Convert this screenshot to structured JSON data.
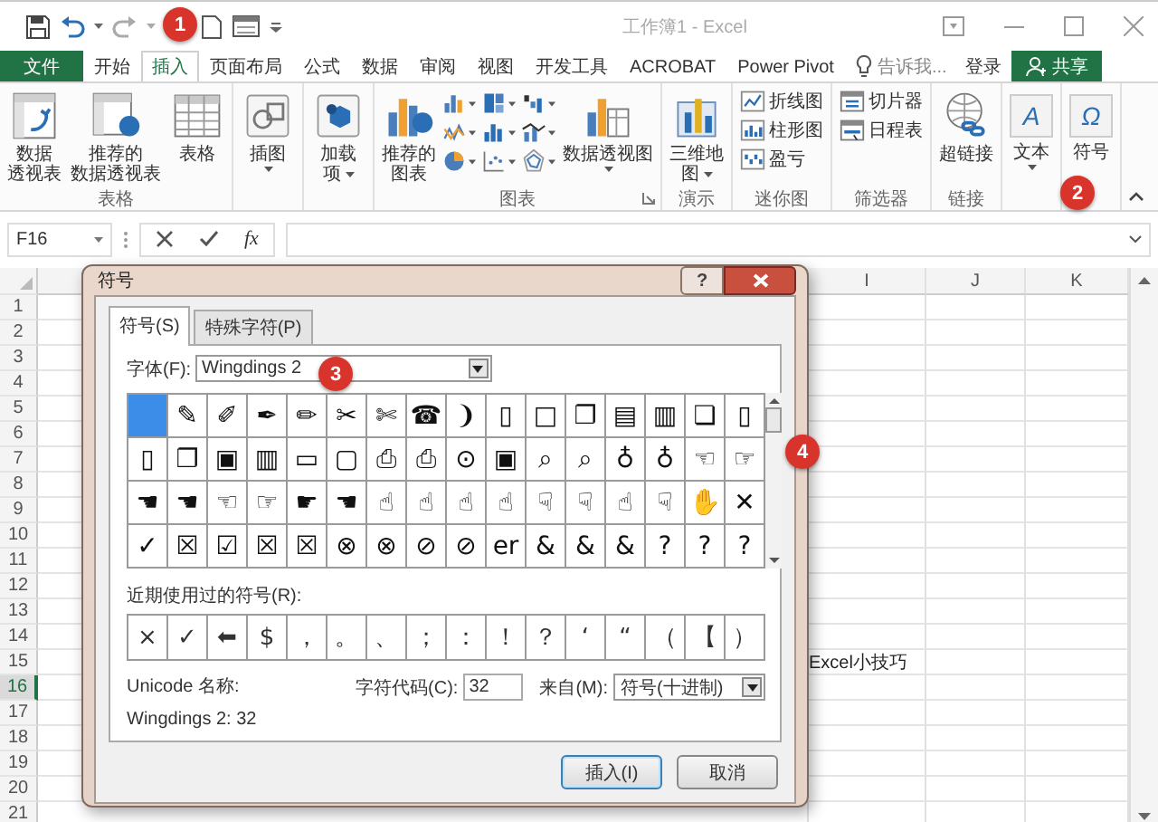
{
  "title_bar": {
    "title": "工作簿1 - Excel"
  },
  "tabs": [
    {
      "label": "文件",
      "kind": "file",
      "selected": false
    },
    {
      "label": "开始",
      "kind": "tab",
      "selected": false
    },
    {
      "label": "插入",
      "kind": "tab",
      "selected": true
    },
    {
      "label": "页面布局",
      "kind": "tab",
      "selected": false
    },
    {
      "label": "公式",
      "kind": "tab",
      "selected": false
    },
    {
      "label": "数据",
      "kind": "tab",
      "selected": false
    },
    {
      "label": "审阅",
      "kind": "tab",
      "selected": false
    },
    {
      "label": "视图",
      "kind": "tab",
      "selected": false
    },
    {
      "label": "开发工具",
      "kind": "tab",
      "selected": false
    },
    {
      "label": "ACROBAT",
      "kind": "tab",
      "selected": false
    },
    {
      "label": "Power Pivot",
      "kind": "tab",
      "selected": false
    }
  ],
  "tell_me": "告诉我...",
  "sign_in": "登录",
  "share": "共享",
  "ribbon": {
    "groups": [
      {
        "label": "表格",
        "items": [
          {
            "kind": "large",
            "lines": [
              "数据",
              "透视表"
            ]
          },
          {
            "kind": "large",
            "lines": [
              "推荐的",
              "数据透视表"
            ]
          },
          {
            "kind": "large",
            "lines": [
              "表格"
            ]
          }
        ]
      },
      {
        "items": [
          {
            "kind": "large",
            "lines": [
              "插图"
            ],
            "dropdown": true
          }
        ]
      },
      {
        "items": [
          {
            "kind": "large",
            "lines": [
              "加载",
              "项"
            ],
            "dropdown": true
          }
        ]
      },
      {
        "label": "图表",
        "launcher": true,
        "items": [
          {
            "kind": "large",
            "lines": [
              "推荐的",
              "图表"
            ]
          },
          {
            "kind": "gallery"
          },
          {
            "kind": "large",
            "lines": [
              "数据透视图"
            ],
            "dropdown": true
          }
        ]
      },
      {
        "label": "演示",
        "items": [
          {
            "kind": "large",
            "lines": [
              "三维地",
              "图"
            ],
            "dropdown": true
          }
        ]
      },
      {
        "label": "迷你图",
        "items": [
          {
            "kind": "small",
            "lines": [
              "折线图"
            ]
          },
          {
            "kind": "small",
            "lines": [
              "柱形图"
            ]
          },
          {
            "kind": "small",
            "lines": [
              "盈亏"
            ]
          }
        ]
      },
      {
        "label": "筛选器",
        "items": [
          {
            "kind": "small",
            "lines": [
              "切片器"
            ]
          },
          {
            "kind": "small",
            "lines": [
              "日程表"
            ]
          }
        ]
      },
      {
        "label": "链接",
        "items": [
          {
            "kind": "large",
            "lines": [
              "超链接"
            ]
          }
        ]
      },
      {
        "items": [
          {
            "kind": "large",
            "glyph": "A",
            "lines": [
              "文本"
            ],
            "dropdown": true
          }
        ]
      },
      {
        "items": [
          {
            "kind": "large",
            "glyph": "Ω",
            "lines": [
              "符号"
            ]
          }
        ]
      }
    ]
  },
  "formula_bar": {
    "name_box": "F16",
    "function_label": "fx"
  },
  "sheet": {
    "columns": [
      "I",
      "J",
      "K"
    ],
    "rows": [
      {
        "label": "1",
        "selected": false
      },
      {
        "label": "2",
        "selected": false
      },
      {
        "label": "3",
        "selected": false
      },
      {
        "label": "4",
        "selected": false
      },
      {
        "label": "5",
        "selected": false
      },
      {
        "label": "6",
        "selected": false
      },
      {
        "label": "7",
        "selected": false
      },
      {
        "label": "8",
        "selected": false
      },
      {
        "label": "9",
        "selected": false
      },
      {
        "label": "10",
        "selected": false
      },
      {
        "label": "11",
        "selected": false
      },
      {
        "label": "12",
        "selected": false
      },
      {
        "label": "13",
        "selected": false
      },
      {
        "label": "14",
        "selected": false
      },
      {
        "label": "15",
        "selected": false,
        "cells": [
          "Excel小技巧"
        ]
      },
      {
        "label": "16",
        "selected": true
      },
      {
        "label": "17",
        "selected": false
      },
      {
        "label": "18",
        "selected": false
      },
      {
        "label": "19",
        "selected": false
      },
      {
        "label": "20",
        "selected": false
      },
      {
        "label": "21",
        "selected": false
      }
    ]
  },
  "dialog": {
    "title": "符号",
    "help": "?",
    "tabs": [
      {
        "label": "符号(S)",
        "selected": true
      },
      {
        "label": "特殊字符(P)",
        "selected": false
      }
    ],
    "font_label": "字体(F):",
    "font_value": "Wingdings 2",
    "symbols": [
      {
        "selected": true
      },
      {
        "glyph": "✎",
        "selected": false
      },
      {
        "glyph": "✐",
        "selected": false
      },
      {
        "glyph": "✒",
        "selected": false
      },
      {
        "glyph": "✏",
        "selected": false
      },
      {
        "glyph": "✂",
        "selected": false
      },
      {
        "glyph": "✄",
        "selected": false
      },
      {
        "glyph": "☎",
        "selected": false
      },
      {
        "glyph": "❩",
        "selected": false
      },
      {
        "glyph": "▯",
        "selected": false
      },
      {
        "glyph": "□",
        "selected": false
      },
      {
        "glyph": "❐",
        "selected": false
      },
      {
        "glyph": "▤",
        "selected": false
      },
      {
        "glyph": "▥",
        "selected": false
      },
      {
        "glyph": "❏",
        "selected": false
      },
      {
        "glyph": "▯",
        "selected": false
      },
      {
        "glyph": "▯",
        "selected": false
      },
      {
        "glyph": "❐",
        "selected": false
      },
      {
        "glyph": "▣",
        "selected": false
      },
      {
        "glyph": "▥",
        "selected": false
      },
      {
        "glyph": "▭",
        "selected": false
      },
      {
        "glyph": "▢",
        "selected": false
      },
      {
        "glyph": "⎙",
        "selected": false
      },
      {
        "glyph": "⎙",
        "selected": false
      },
      {
        "glyph": "⊙",
        "selected": false
      },
      {
        "glyph": "▣",
        "selected": false
      },
      {
        "glyph": "⌕",
        "selected": false
      },
      {
        "glyph": "⌕",
        "selected": false
      },
      {
        "glyph": "♁",
        "selected": false
      },
      {
        "glyph": "♁",
        "selected": false
      },
      {
        "glyph": "☜",
        "selected": false
      },
      {
        "glyph": "☞",
        "selected": false
      },
      {
        "glyph": "☚",
        "selected": false
      },
      {
        "glyph": "☚",
        "selected": false
      },
      {
        "glyph": "☜",
        "selected": false
      },
      {
        "glyph": "☞",
        "selected": false
      },
      {
        "glyph": "☛",
        "selected": false
      },
      {
        "glyph": "☚",
        "selected": false
      },
      {
        "glyph": "☝",
        "selected": false
      },
      {
        "glyph": "☝",
        "selected": false
      },
      {
        "glyph": "☝",
        "selected": false
      },
      {
        "glyph": "☝",
        "selected": false
      },
      {
        "glyph": "☟",
        "selected": false
      },
      {
        "glyph": "☟",
        "selected": false
      },
      {
        "glyph": "☝",
        "selected": false
      },
      {
        "glyph": "☟",
        "selected": false
      },
      {
        "glyph": "✋",
        "selected": false
      },
      {
        "glyph": "✕",
        "selected": false
      },
      {
        "glyph": "✓",
        "selected": false
      },
      {
        "glyph": "☒",
        "selected": false
      },
      {
        "glyph": "☑",
        "selected": false
      },
      {
        "glyph": "☒",
        "selected": false
      },
      {
        "glyph": "☒",
        "selected": false
      },
      {
        "glyph": "⊗",
        "selected": false
      },
      {
        "glyph": "⊗",
        "selected": false
      },
      {
        "glyph": "⊘",
        "selected": false
      },
      {
        "glyph": "⊘",
        "selected": false
      },
      {
        "glyph": "er",
        "selected": false
      },
      {
        "glyph": "&",
        "selected": false
      },
      {
        "glyph": "&",
        "selected": false
      },
      {
        "glyph": "&",
        "selected": false
      },
      {
        "glyph": "?",
        "selected": false
      },
      {
        "glyph": "?",
        "selected": false
      },
      {
        "glyph": "?",
        "selected": false
      }
    ],
    "recent_label": "近期使用过的符号(R):",
    "recent": [
      "×",
      "✓",
      "⬅",
      "$",
      "，",
      "。",
      "、",
      "；",
      "：",
      "！",
      "？",
      "‘",
      "“",
      "（",
      "【",
      "）"
    ],
    "unicode_name_label": "Unicode 名称:",
    "unicode_name": "Wingdings 2: 32",
    "char_code_label": "字符代码(C):",
    "char_code": "32",
    "from_label": "来自(M):",
    "from_value": "符号(十进制)",
    "buttons": [
      {
        "label": "插入(I)",
        "default": true
      },
      {
        "label": "取消",
        "default": false
      }
    ]
  },
  "callouts": [
    {
      "text": "1"
    },
    {
      "text": "2"
    },
    {
      "text": "3"
    },
    {
      "text": "4"
    }
  ]
}
